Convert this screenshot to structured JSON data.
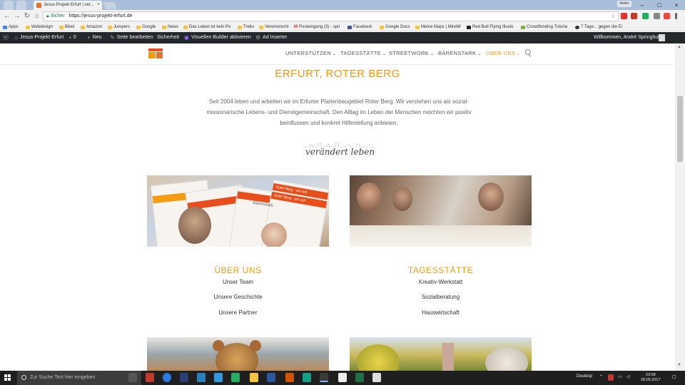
{
  "browser": {
    "tab_title": "Jesus-Projekt Erfurt | ver...",
    "user_badge": "Andre",
    "window_controls": [
      "–",
      "□",
      "×"
    ],
    "secure_label": "Sicher",
    "url": "https://jesus-projekt-erfurt.de"
  },
  "bookmarks": [
    {
      "label": "Apps"
    },
    {
      "label": "Webdesign"
    },
    {
      "label": "Bibel"
    },
    {
      "label": "Amazon"
    },
    {
      "label": "Jumpers"
    },
    {
      "label": "Google"
    },
    {
      "label": "News"
    },
    {
      "label": "Das Leben ist kein Po"
    },
    {
      "label": "Trello"
    },
    {
      "label": "Vereinsrecht"
    },
    {
      "label": "Posteingang (3) - spri"
    },
    {
      "label": "Facebook"
    },
    {
      "label": "Google Docs"
    },
    {
      "label": "Meine Maps | MindM"
    },
    {
      "label": "Red Bull Flying Illusio"
    },
    {
      "label": "Crowdfunding Tutoria"
    },
    {
      "label": "7 Tage... gegen die Ei"
    }
  ],
  "adminbar": {
    "site": "Jesus-Projekt Erfurt",
    "comments": "0",
    "new": "Neu",
    "edit": "Seite bearbeiten",
    "security": "Sicherheit",
    "builder": "Visuellen Builder aktivieren",
    "ad": "Ad Inserter",
    "welcome": "Willkommen, André Springhut"
  },
  "menu": {
    "items": [
      {
        "label": "UNTERSTÜTZEN"
      },
      {
        "label": "TAGESSTÄTTE"
      },
      {
        "label": "STREETWORK"
      },
      {
        "label": "BÄRENSTARK"
      },
      {
        "label": "ÜBER UNS"
      }
    ],
    "chevron": "⌄"
  },
  "content": {
    "title": "ERFURT, ROTER BERG",
    "intro": "Seit 2004 leben und arbeiten wir im Erfurter Plattenbaugebiet Roter Berg. Wir verstehen uns als sozial-missionarische Lebens- und Dienstgemeinschaft. Den Alltag im Leben der Menschen möchten wir positiv beinflussen und konkret Hilfestellung anbieten.",
    "tagline": "verändert leben",
    "mag_text_1": "Roter Berg - ein sch",
    "mag_text_2": "Roter Berg - ein sch",
    "mag_text_3": "Bärenstark"
  },
  "columns": [
    {
      "title": "ÜBER UNS",
      "links": [
        "Unser Team",
        "Unsere Geschichte",
        "Unsere Partner"
      ]
    },
    {
      "title": "TAGESSTÄTTE",
      "links": [
        "Kreativ-Werkstatt",
        "Sozialberatung",
        "Hauswirtschaft"
      ]
    }
  ],
  "taskbar": {
    "search_placeholder": "Zur Suche Text hier eingeben",
    "desktop": "Desktop",
    "time": "23:08",
    "date": "28.05.2017"
  },
  "colors": {
    "accent": "#f39c12",
    "adminbar": "#23282d",
    "taskbar": "#1f1f1f"
  }
}
